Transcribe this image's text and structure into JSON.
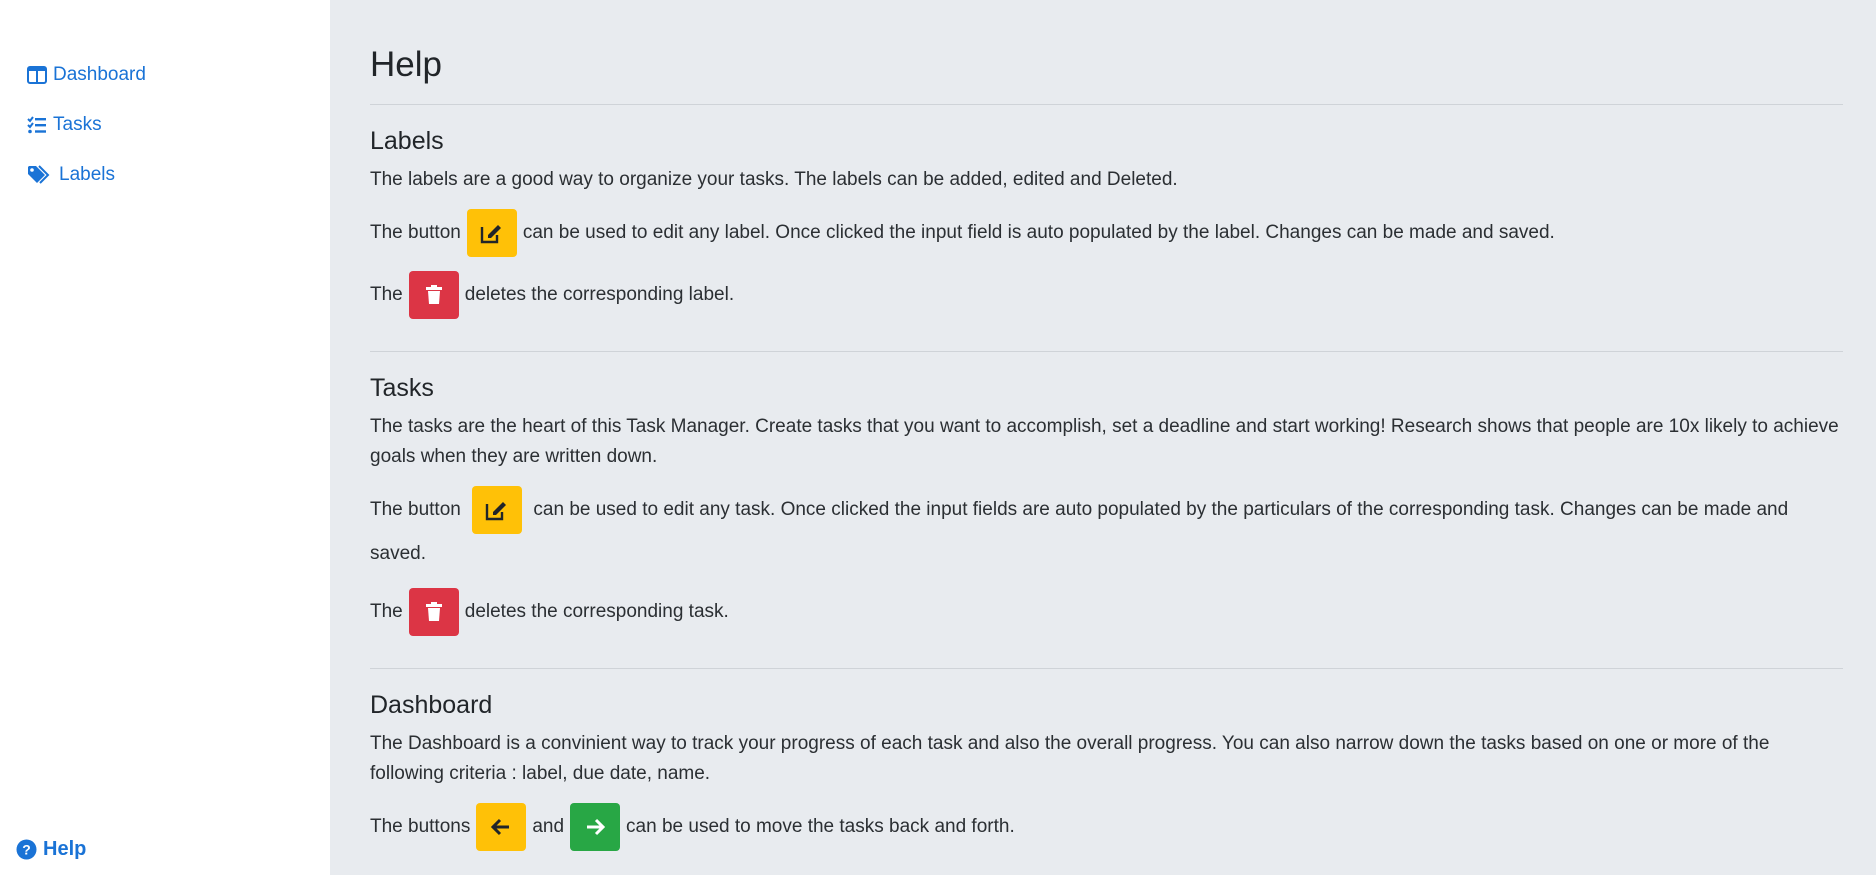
{
  "sidebar": {
    "items": [
      {
        "label": "Dashboard",
        "icon": "columns-icon"
      },
      {
        "label": "Tasks",
        "icon": "tasks-icon"
      },
      {
        "label": "Labels",
        "icon": "tags-icon"
      }
    ],
    "help": {
      "label": "Help",
      "icon": "question-circle-icon"
    }
  },
  "main": {
    "title": "Help",
    "labels": {
      "heading": "Labels",
      "intro": "The labels are a good way to organize your tasks. The labels can be added, edited and Deleted.",
      "edit_prefix": "The button",
      "edit_suffix": "can be used to edit any label. Once clicked the input field is auto populated by the label. Changes can be made and saved.",
      "delete_prefix": "The",
      "delete_suffix": "deletes the corresponding label."
    },
    "tasks": {
      "heading": "Tasks",
      "intro": "The tasks are the heart of this Task Manager. Create tasks that you want to accomplish, set a deadline and start working! Research shows that people are 10x likely to achieve goals when they are written down.",
      "edit_prefix": "The button",
      "edit_suffix": "can be used to edit any task. Once clicked the input fields are auto populated by the particulars of the corresponding task. Changes can be made and saved.",
      "delete_prefix": "The",
      "delete_suffix": "deletes the corresponding task."
    },
    "dashboard": {
      "heading": "Dashboard",
      "intro": "The Dashboard is a convinient way to track your progress of each task and also the overall progress. You can also narrow down the tasks based on one or more of the following criteria : label, due date, name.",
      "move_prefix": "The buttons",
      "move_middle": "and",
      "move_suffix": "can be used to move the tasks back and forth."
    }
  },
  "colors": {
    "link": "#1a73d6",
    "warning": "#ffc107",
    "danger": "#dc3545",
    "success": "#28a745",
    "main_bg": "#e8ebef"
  }
}
